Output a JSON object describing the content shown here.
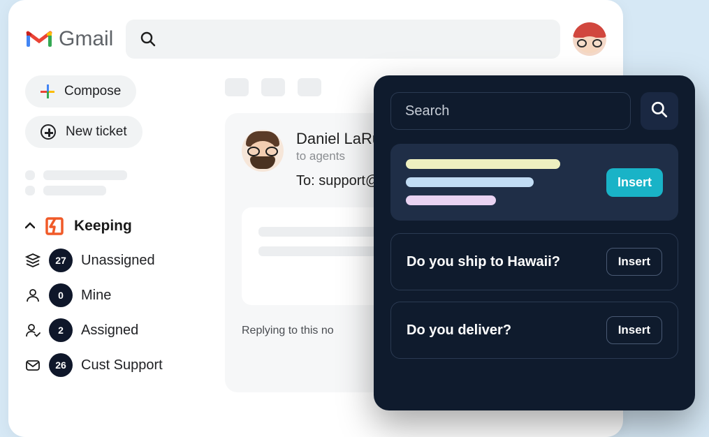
{
  "header": {
    "app_name": "Gmail",
    "search_placeholder": ""
  },
  "sidebar": {
    "compose_label": "Compose",
    "new_ticket_label": "New ticket",
    "keeping_label": "Keeping",
    "folders": [
      {
        "icon": "stack",
        "count": "27",
        "label": "Unassigned"
      },
      {
        "icon": "person",
        "count": "0",
        "label": "Mine"
      },
      {
        "icon": "person-check",
        "count": "2",
        "label": "Assigned"
      },
      {
        "icon": "envelope",
        "count": "26",
        "label": "Cust Support"
      }
    ]
  },
  "email": {
    "sender_name": "Daniel LaRu",
    "to_agents": "to agents",
    "to_line": "To: support@",
    "reply_footer": "Replying to this no"
  },
  "panel": {
    "search_placeholder": "Search",
    "insert_label": "Insert",
    "snippets": [
      {
        "title": "Do you ship to Hawaii?",
        "insert": "Insert"
      },
      {
        "title": "Do you deliver?",
        "insert": "Insert"
      }
    ]
  }
}
